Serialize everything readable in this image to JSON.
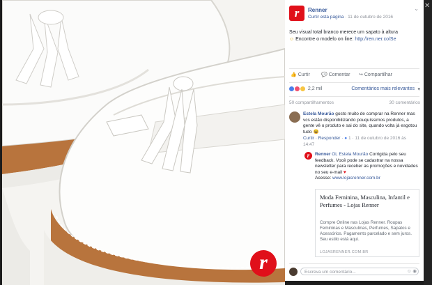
{
  "post": {
    "page_name": "Renner",
    "follow_link": "Curtir esta página",
    "date": "11 de outubro de 2016",
    "text_line1": "Seu visual total branco merece um sapato à altura",
    "text_line2_prefix": "Encontre o modelo on line:",
    "link": "http://ren.ner.co/Se"
  },
  "actions": {
    "like": "Curtir",
    "comment": "Comentar",
    "share": "Compartilhar"
  },
  "reactions": {
    "count": "2,2 mil",
    "sort": "Comentários mais relevantes"
  },
  "counts": {
    "shares": "50 compartilhamentos",
    "comments": "30 comentários"
  },
  "comment1": {
    "author": "Estela Mourão",
    "text": "gosto muito de comprar na Renner mas vcs estão disponibilizando pouquíssimos produtos, a gente vê o produto e sai do site, quando volta já esgotou tudo",
    "like": "Curtir",
    "reply": "Responder",
    "likes": "1",
    "date": "11 de outubro de 2016 às 14:47"
  },
  "reply1": {
    "author": "Renner",
    "mention": "Oi, Estela Mourão",
    "text": "Corrigida pelo seu feedback. Você pode se cadastrar na nossa newsletter para receber as promoções e novidades no seu e-mail",
    "access": "Acesse:",
    "access_link": "www.lojasrenner.com.br"
  },
  "card": {
    "title": "Moda Feminina, Masculina, Infantil e Perfumes - Lojas Renner",
    "desc": "Compre Online nas Lojas Renner. Roupas Femininas e Masculinas, Perfumes, Sapatos e Acessórios. Pagamento parcelado e sem juros. Seu estilo está aqui.",
    "domain": "LOJASRENNER.COM.BR"
  },
  "reply_box": {
    "placeholder": "Escreva um comentário..."
  },
  "colors": {
    "brand_red": "#e0101a",
    "link_blue": "#365899"
  }
}
